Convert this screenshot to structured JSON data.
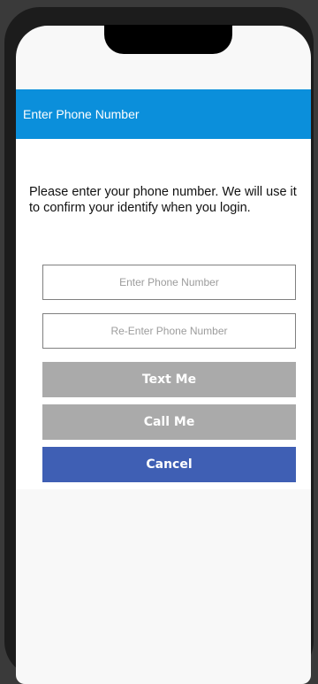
{
  "header": {
    "title": "Enter Phone Number"
  },
  "main": {
    "instructions": "Please enter your phone number. We will use it to confirm your identify when you login.",
    "phone_input": {
      "placeholder": "Enter Phone Number",
      "value": ""
    },
    "reenter_input": {
      "placeholder": "Re-Enter Phone Number",
      "value": ""
    },
    "text_me_label": "Text Me",
    "call_me_label": "Call Me",
    "cancel_label": "Cancel"
  },
  "colors": {
    "title_bar": "#0b8fdb",
    "disabled_button": "#aaaaaa",
    "cancel_button": "#3f5fb4"
  }
}
